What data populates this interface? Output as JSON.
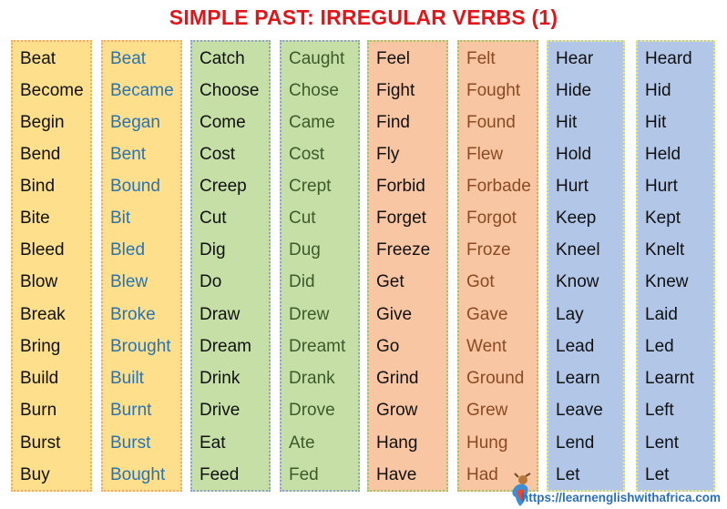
{
  "title": "SIMPLE PAST: IRREGULAR VERBS (1)",
  "columns": [
    {
      "name": "base-1",
      "theme": "yellow",
      "text": "txt-base",
      "words": [
        "Beat",
        "Become",
        "Begin",
        "Bend",
        "Bind",
        "Bite",
        "Bleed",
        "Blow",
        "Break",
        "Bring",
        "Build",
        "Burn",
        "Burst",
        "Buy"
      ]
    },
    {
      "name": "past-1",
      "theme": "yellow",
      "text": "txt-y",
      "words": [
        "Beat",
        "Became",
        "Began",
        "Bent",
        "Bound",
        "Bit",
        "Bled",
        "Blew",
        "Broke",
        "Brought",
        "Built",
        "Burnt",
        "Burst",
        "Bought"
      ]
    },
    {
      "name": "base-2",
      "theme": "green",
      "text": "txt-base",
      "words": [
        "Catch",
        "Choose",
        "Come",
        "Cost",
        "Creep",
        "Cut",
        "Dig",
        "Do",
        "Draw",
        "Dream",
        "Drink",
        "Drive",
        "Eat",
        "Feed"
      ]
    },
    {
      "name": "past-2",
      "theme": "green",
      "text": "txt-g",
      "words": [
        "Caught",
        "Chose",
        "Came",
        "Cost",
        "Crept",
        "Cut",
        "Dug",
        "Did",
        "Drew",
        "Dreamt",
        "Drank",
        "Drove",
        "Ate",
        "Fed"
      ]
    },
    {
      "name": "base-3",
      "theme": "salmon",
      "text": "txt-base",
      "words": [
        "Feel",
        "Fight",
        "Find",
        "Fly",
        "Forbid",
        "Forget",
        "Freeze",
        "Get",
        "Give",
        "Go",
        "Grind",
        "Grow",
        "Hang",
        "Have"
      ]
    },
    {
      "name": "past-3",
      "theme": "salmon",
      "text": "txt-s",
      "words": [
        "Felt",
        "Fought",
        "Found",
        "Flew",
        "Forbade",
        "Forgot",
        "Froze",
        "Got",
        "Gave",
        "Went",
        "Ground",
        "Grew",
        "Hung",
        "Had"
      ]
    },
    {
      "name": "base-4",
      "theme": "blue",
      "text": "txt-b",
      "words": [
        "Hear",
        "Hide",
        "Hit",
        "Hold",
        "Hurt",
        "Keep",
        "Kneel",
        "Know",
        "Lay",
        "Lead",
        "Learn",
        "Leave",
        "Lend",
        "Let"
      ]
    },
    {
      "name": "past-4",
      "theme": "blue",
      "text": "txt-b",
      "words": [
        "Heard",
        "Hid",
        "Hit",
        "Held",
        "Hurt",
        "Kept",
        "Knelt",
        "Knew",
        "Laid",
        "Led",
        "Learnt",
        "Left",
        "Lent",
        "Let"
      ]
    }
  ],
  "footer": {
    "logo_icon": "africa-mascot-logo-icon",
    "url": "https://learnenglishwithafrica.com"
  }
}
